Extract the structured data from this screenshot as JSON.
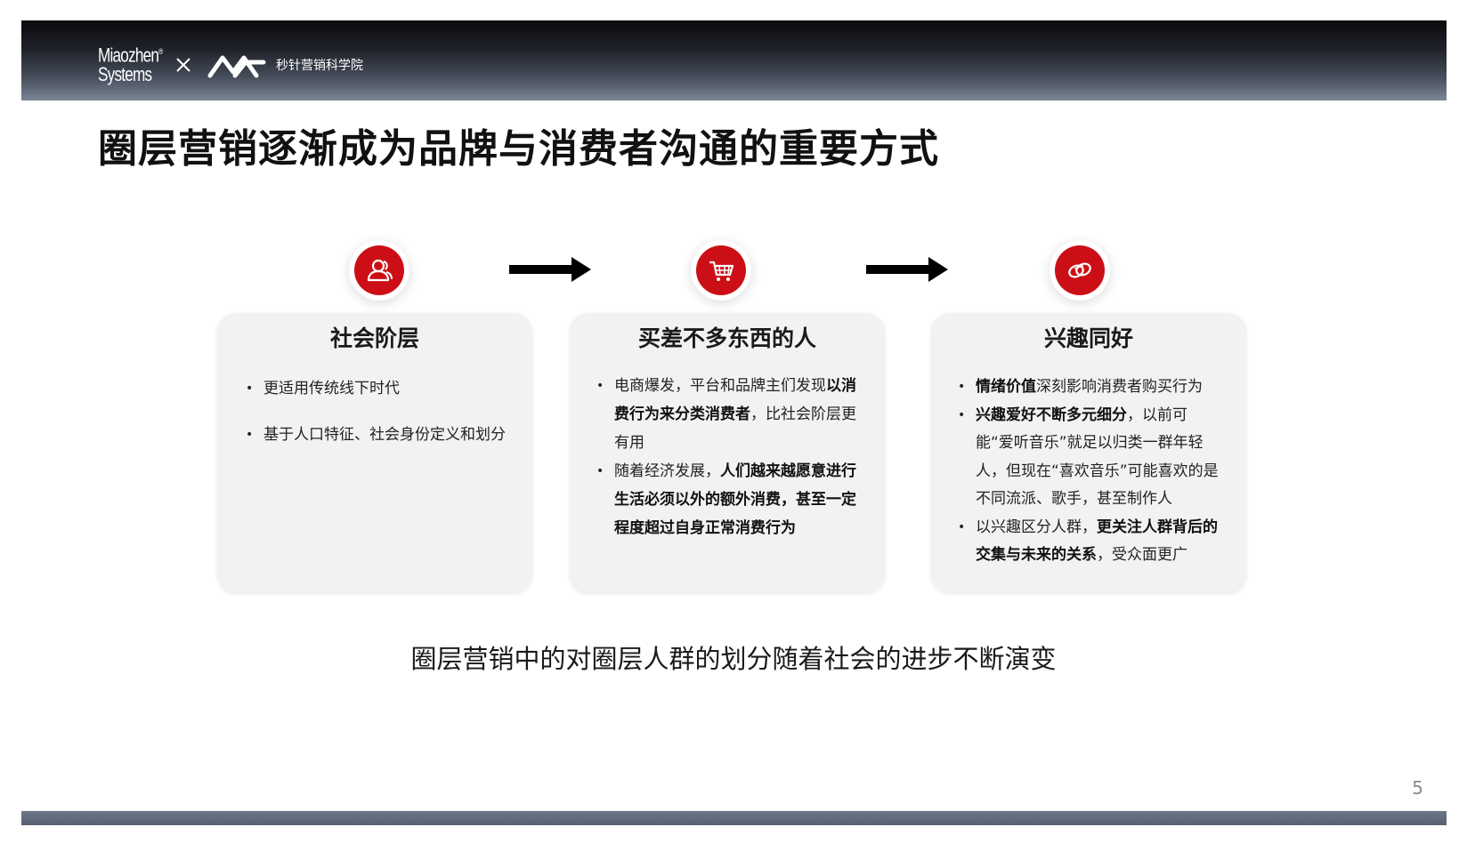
{
  "header": {
    "brand_line1": "Miaozhen",
    "brand_line2": "Systems",
    "brand_reg": "®",
    "academy": "秒针营销科学院",
    "x_icon": "close-x-icon",
    "logo_icon": "mz-wave-logo-icon"
  },
  "title": "圈层营销逐渐成为品牌与消费者沟通的重要方式",
  "accent_color": "#cc0f16",
  "steps": [
    {
      "icon": "people-icon",
      "title": "社会阶层",
      "bullets": [
        [
          {
            "t": "更适用传统线下时代",
            "b": false
          }
        ],
        [
          {
            "t": "基于人口特征、社会身份定义和划分",
            "b": false
          }
        ]
      ]
    },
    {
      "icon": "shopping-cart-icon",
      "title": "买差不多东西的人",
      "bullets": [
        [
          {
            "t": "电商爆发，平台和品牌主们发现",
            "b": false
          },
          {
            "t": "以消费行为来分类消费者",
            "b": true
          },
          {
            "t": "，比社会阶层更有用",
            "b": false
          }
        ],
        [
          {
            "t": "随着经济发展，",
            "b": false
          },
          {
            "t": "人们越来越愿意进行生活必须以外的额外消费，甚至一定程度超过自身正常消费行为",
            "b": true
          }
        ]
      ]
    },
    {
      "icon": "interest-rings-icon",
      "title": "兴趣同好",
      "bullets": [
        [
          {
            "t": "情绪价值",
            "b": true
          },
          {
            "t": "深刻影响消费者购买行为",
            "b": false
          }
        ],
        [
          {
            "t": "兴趣爱好不断多元细分",
            "b": true
          },
          {
            "t": "，以前可能“爱听音乐”就足以归类一群年轻人，但现在“喜欢音乐”可能喜欢的是不同流派、歌手，甚至制作人",
            "b": false
          }
        ],
        [
          {
            "t": "以兴趣区分人群，",
            "b": false
          },
          {
            "t": "更关注人群背后的交集与未来的关系",
            "b": true
          },
          {
            "t": "，受众面更广",
            "b": false
          }
        ]
      ]
    }
  ],
  "arrow_icon": "right-arrow-icon",
  "summary": "圈层营销中的对圈层人群的划分随着社会的进步不断演变",
  "page_number": "5"
}
